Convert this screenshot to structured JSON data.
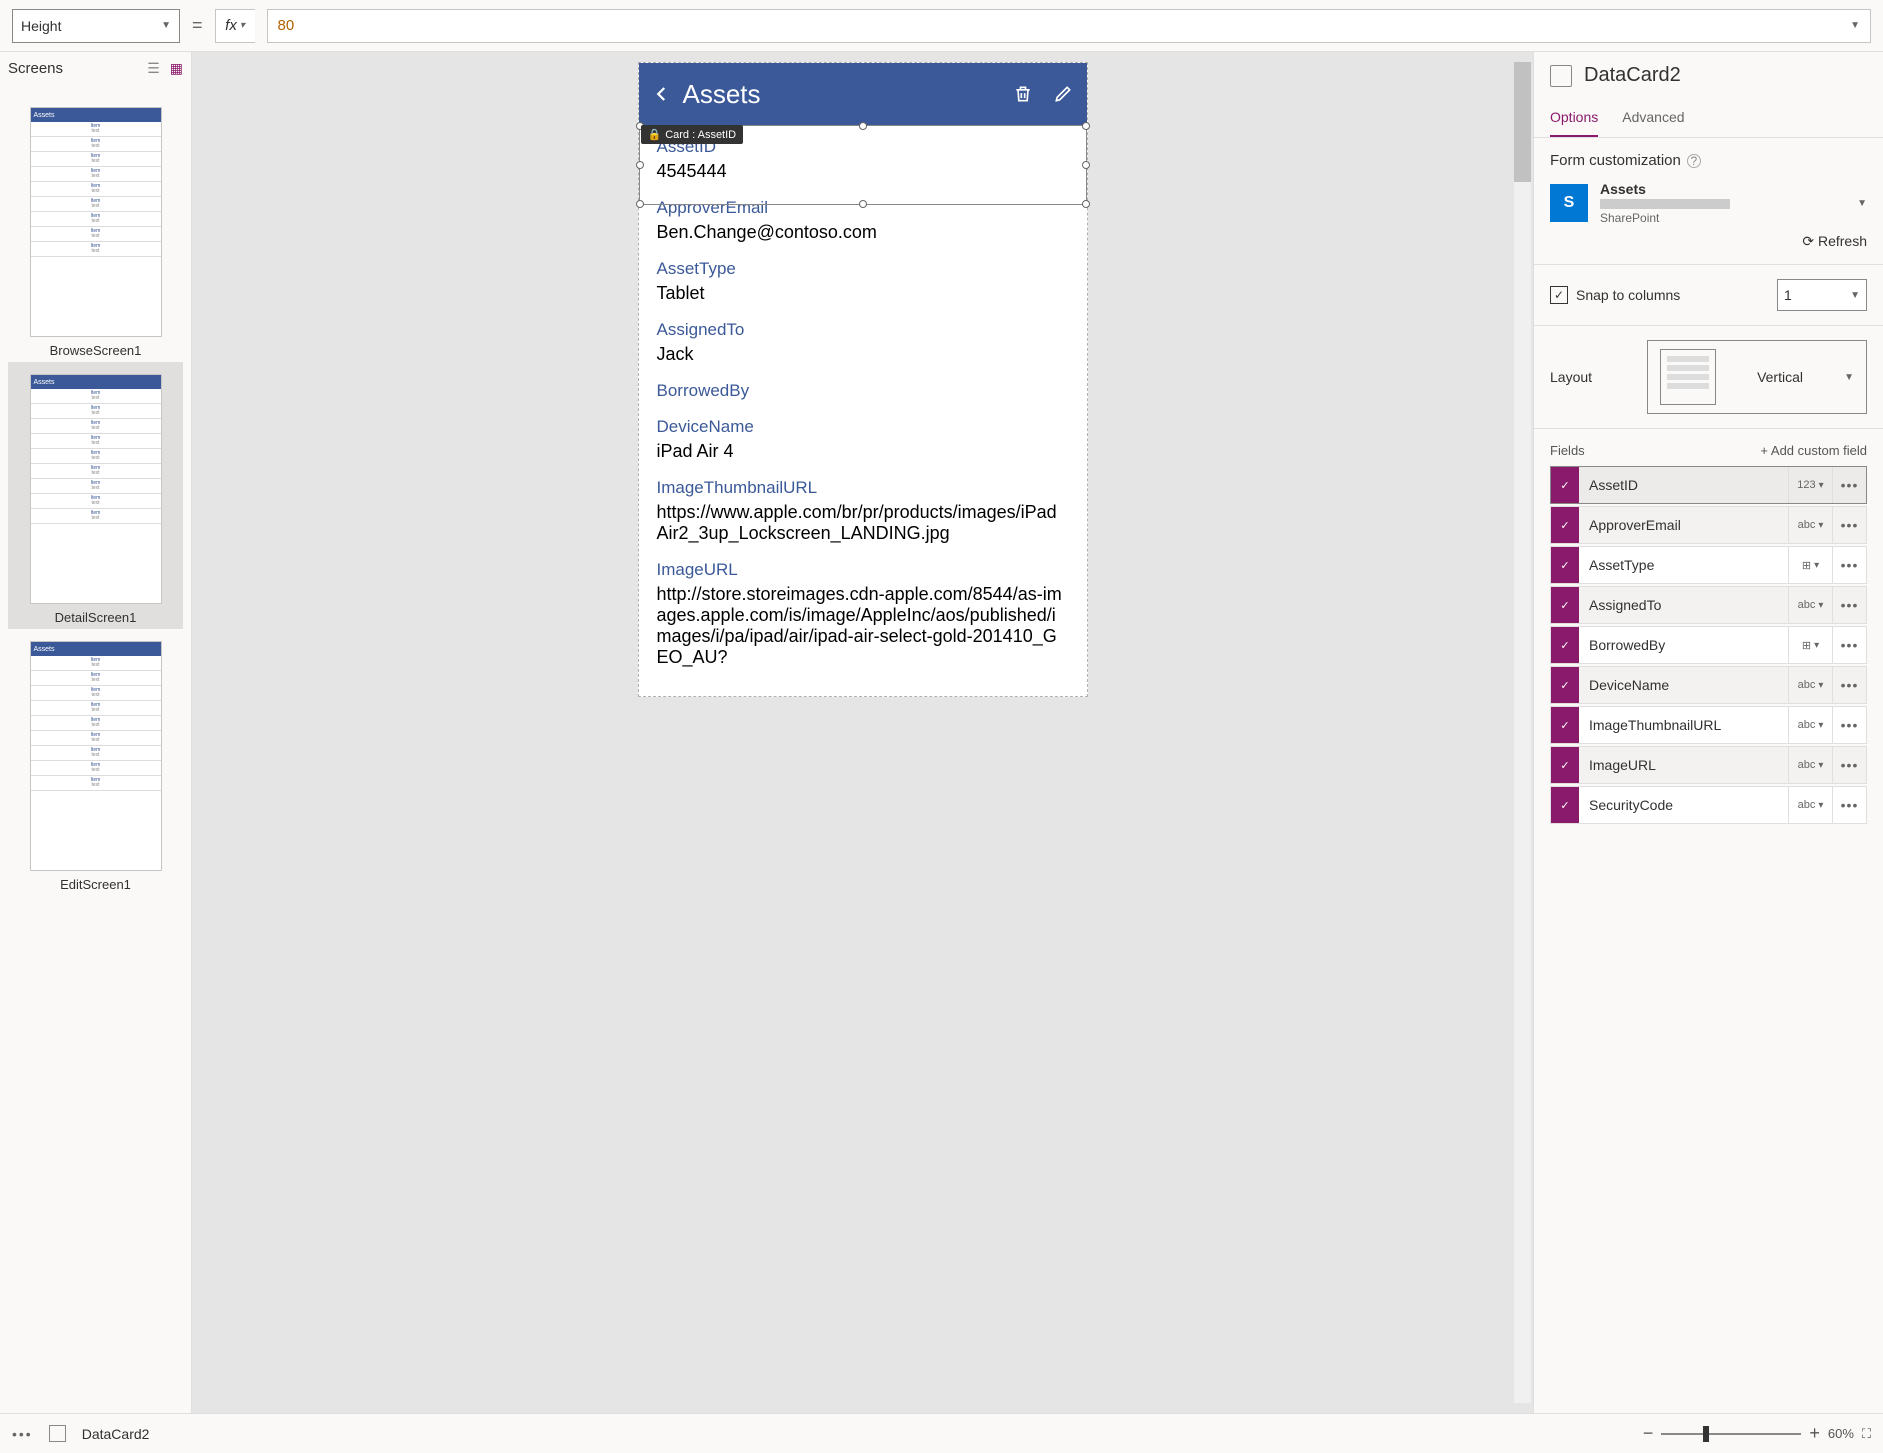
{
  "toolbar": {
    "property": "Height",
    "formula": "80",
    "fx_label": "fx"
  },
  "left": {
    "title": "Screens",
    "screens": [
      "BrowseScreen1",
      "DetailScreen1",
      "EditScreen1"
    ],
    "selected_index": 1,
    "thumb_title": "Assets"
  },
  "canvas": {
    "header_title": "Assets",
    "tooltip_label": "Card : AssetID",
    "fields": [
      {
        "label": "AssetID",
        "value": "4545444"
      },
      {
        "label": "ApproverEmail",
        "value": "Ben.Change@contoso.com"
      },
      {
        "label": "AssetType",
        "value": "Tablet"
      },
      {
        "label": "AssignedTo",
        "value": "Jack"
      },
      {
        "label": "BorrowedBy",
        "value": ""
      },
      {
        "label": "DeviceName",
        "value": "iPad Air 4"
      },
      {
        "label": "ImageThumbnailURL",
        "value": "https://www.apple.com/br/pr/products/images/iPadAir2_3up_Lockscreen_LANDING.jpg"
      },
      {
        "label": "ImageURL",
        "value": "http://store.storeimages.cdn-apple.com/8544/as-images.apple.com/is/image/AppleInc/aos/published/images/i/pa/ipad/air/ipad-air-select-gold-201410_GEO_AU?"
      }
    ]
  },
  "right": {
    "title": "DataCard2",
    "tabs": {
      "options": "Options",
      "advanced": "Advanced"
    },
    "form_custom_label": "Form customization",
    "datasource": {
      "name": "Assets",
      "sub": "SharePoint",
      "icon_letter": "S"
    },
    "refresh_label": "Refresh",
    "snap_label": "Snap to columns",
    "snap_checked": true,
    "columns_value": "1",
    "layout_label": "Layout",
    "layout_value": "Vertical",
    "fields_label": "Fields",
    "add_field_label": "+  Add custom field",
    "fields": [
      {
        "name": "AssetID",
        "type": "123",
        "selected": true
      },
      {
        "name": "ApproverEmail",
        "type": "abc"
      },
      {
        "name": "AssetType",
        "type": "grid"
      },
      {
        "name": "AssignedTo",
        "type": "abc"
      },
      {
        "name": "BorrowedBy",
        "type": "grid"
      },
      {
        "name": "DeviceName",
        "type": "abc"
      },
      {
        "name": "ImageThumbnailURL",
        "type": "abc"
      },
      {
        "name": "ImageURL",
        "type": "abc"
      },
      {
        "name": "SecurityCode",
        "type": "abc"
      }
    ]
  },
  "bottom": {
    "breadcrumb": "DataCard2",
    "zoom": "60%"
  }
}
